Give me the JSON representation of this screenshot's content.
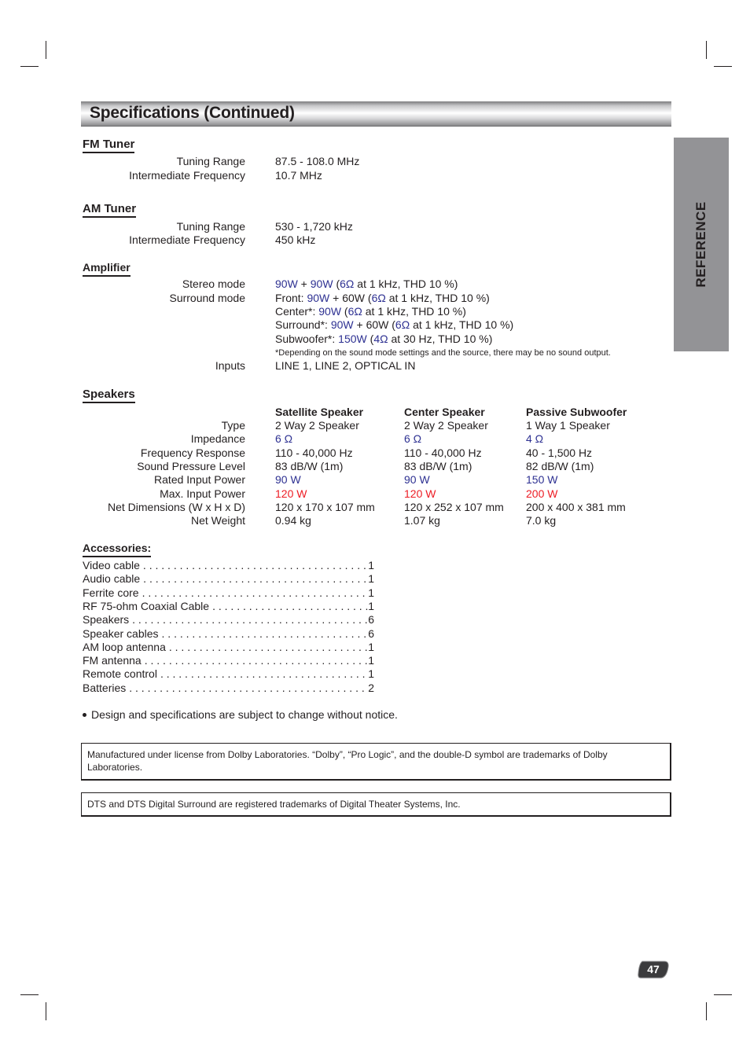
{
  "page": {
    "title": "Specifications (Continued)",
    "side_tab": "REFERENCE",
    "page_number": "47"
  },
  "fm_tuner": {
    "heading": "FM Tuner",
    "rows": [
      {
        "label": "Tuning Range",
        "value": "87.5 - 108.0 MHz"
      },
      {
        "label": "Intermediate Frequency",
        "value": "10.7 MHz"
      }
    ]
  },
  "am_tuner": {
    "heading": "AM Tuner",
    "rows": [
      {
        "label": "Tuning Range",
        "value": "530 - 1,720 kHz"
      },
      {
        "label": "Intermediate Frequency",
        "value": "450 kHz"
      }
    ]
  },
  "amplifier": {
    "heading": "Amplifier",
    "stereo_label": "Stereo mode",
    "stereo": {
      "p1": "90W",
      "plus": " + ",
      "p2": "90W",
      "open": " (",
      "ohm": "6Ω",
      "rest": " at 1 kHz, THD 10 %)"
    },
    "surround_label": "Surround mode",
    "front": {
      "prefix": "Front: ",
      "p1": "90W",
      "mid": " + 60W (",
      "ohm": "6Ω",
      "rest": " at 1 kHz, THD 10 %)"
    },
    "center": {
      "prefix": "Center*: ",
      "p1": "90W",
      "mid": " (",
      "ohm": "6Ω",
      "rest": " at 1 kHz, THD 10 %)"
    },
    "surround": {
      "prefix": "Surround*: ",
      "p1": "90W",
      "mid": " + 60W (",
      "ohm": "6Ω",
      "rest": " at 1 kHz, THD 10 %)"
    },
    "subwoofer": {
      "prefix": "Subwoofer*: ",
      "p1": "150W",
      "mid": " (",
      "ohm": "4Ω",
      "rest": " at 30 Hz, THD 10 %)"
    },
    "footnote": "*Depending on the sound mode settings and the source, there may be no sound output.",
    "inputs_label": "Inputs",
    "inputs_value": "LINE 1, LINE 2, OPTICAL IN"
  },
  "speakers": {
    "heading": "Speakers",
    "columns": [
      "Satellite Speaker",
      "Center Speaker",
      "Passive Subwoofer"
    ],
    "rows": [
      {
        "label": "Type",
        "values": [
          "2 Way 2 Speaker",
          "2 Way 2 Speaker",
          "1 Way 1 Speaker"
        ],
        "color": ""
      },
      {
        "label": "Impedance",
        "values": [
          "6 Ω",
          "6 Ω",
          "4 Ω"
        ],
        "color": "blue"
      },
      {
        "label": "Frequency Response",
        "values": [
          "110 - 40,000 Hz",
          "110 - 40,000 Hz",
          "40 - 1,500 Hz"
        ],
        "color": ""
      },
      {
        "label": "Sound Pressure Level",
        "values": [
          "83 dB/W (1m)",
          "83 dB/W (1m)",
          "82 dB/W (1m)"
        ],
        "color": ""
      },
      {
        "label": "Rated Input Power",
        "values": [
          "90 W",
          "90 W",
          "150 W"
        ],
        "color": "blue"
      },
      {
        "label": "Max. Input Power",
        "values": [
          "120 W",
          "120 W",
          "200 W"
        ],
        "color": "red"
      },
      {
        "label": "Net Dimensions (W x H x D)",
        "values": [
          "120 x 170 x 107 mm",
          "120 x 252 x 107 mm",
          "200 x 400 x 381 mm"
        ],
        "color": ""
      },
      {
        "label": "Net Weight",
        "values": [
          "0.94 kg",
          "1.07 kg",
          "7.0 kg"
        ],
        "color": ""
      }
    ]
  },
  "accessories": {
    "heading": "Accessories:",
    "items": [
      {
        "name": "Video cable",
        "qty": "1"
      },
      {
        "name": "Audio cable",
        "qty": "1"
      },
      {
        "name": "Ferrite core",
        "qty": "1"
      },
      {
        "name": "RF 75-ohm Coaxial Cable",
        "qty": "1"
      },
      {
        "name": "Speakers",
        "qty": "6"
      },
      {
        "name": "Speaker cables",
        "qty": "6"
      },
      {
        "name": "AM loop antenna",
        "qty": "1"
      },
      {
        "name": "FM antenna",
        "qty": "1"
      },
      {
        "name": "Remote control",
        "qty": "1"
      },
      {
        "name": "Batteries",
        "qty": "2"
      }
    ]
  },
  "notice": "Design and specifications are subject to change without notice.",
  "dolby_notice": "Manufactured under license from Dolby Laboratories. “Dolby”, “Pro Logic”, and the double-D symbol are trademarks of Dolby Laboratories.",
  "dts_notice": "DTS and DTS Digital Surround are registered trademarks of Digital Theater Systems, Inc.",
  "colors": {
    "accent_blue": "#2e3192",
    "accent_red": "#ed1c24",
    "side_tab_gray": "#939396"
  }
}
